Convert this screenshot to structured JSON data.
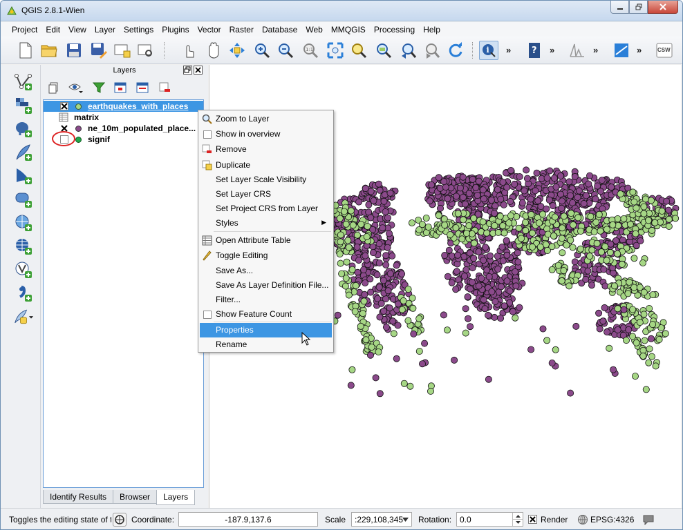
{
  "window": {
    "title": "QGIS 2.8.1-Wien",
    "min": "0",
    "max": "1",
    "close": "r"
  },
  "menu": [
    "Project",
    "Edit",
    "View",
    "Layer",
    "Settings",
    "Plugins",
    "Vector",
    "Raster",
    "Database",
    "Web",
    "MMQGIS",
    "Processing",
    "Help"
  ],
  "toolbar": {
    "more": "»",
    "csw": "CSW"
  },
  "layers_panel": {
    "title": "Layers",
    "layers": [
      {
        "name": "earthquakes_with_places",
        "checked": true,
        "symbol_color": "#a6d785",
        "selected": true
      },
      {
        "name": "matrix",
        "checked": null,
        "symbol": "table"
      },
      {
        "name": "ne_10m_populated_place...",
        "checked": true,
        "symbol_color": "#8b4a8b"
      },
      {
        "name": "signif",
        "checked": false,
        "symbol_color": "#22a84a"
      }
    ],
    "tabs": [
      "Identify Results",
      "Browser",
      "Layers"
    ],
    "active_tab": "Layers"
  },
  "context_menu": {
    "items": [
      {
        "label": "Zoom to Layer",
        "icon": "zoom-icon"
      },
      {
        "label": "Show in overview",
        "icon": "checkbox"
      },
      {
        "label": "Remove",
        "icon": "remove-layer-icon"
      },
      {
        "label": "Duplicate",
        "icon": "duplicate-icon"
      },
      {
        "label": "Set Layer Scale Visibility"
      },
      {
        "label": "Set Layer CRS"
      },
      {
        "label": "Set Project CRS from Layer"
      },
      {
        "label": "Styles",
        "submenu": true
      },
      {
        "label": "Open Attribute Table",
        "icon": "table-icon"
      },
      {
        "label": "Toggle Editing",
        "icon": "pencil-icon"
      },
      {
        "label": "Save As..."
      },
      {
        "label": "Save As Layer Definition File..."
      },
      {
        "label": "Filter..."
      },
      {
        "label": "Show Feature Count",
        "icon": "checkbox"
      },
      {
        "label": "Properties",
        "highlighted": true
      },
      {
        "label": "Rename"
      }
    ]
  },
  "statusbar": {
    "message": "Toggles the editing state of the",
    "coordinate_label": "Coordinate:",
    "coordinate_value": "-187.9,137.6",
    "scale_label": "Scale",
    "scale_value": ":229,108,345",
    "rotation_label": "Rotation:",
    "rotation_value": "0.0",
    "render_label": "Render",
    "render_checked": true,
    "crs": "EPSG:4326"
  },
  "colors": {
    "accent": "#3d96e3",
    "populated_places": "#8b4a8b",
    "earthquakes": "#a6d785"
  }
}
